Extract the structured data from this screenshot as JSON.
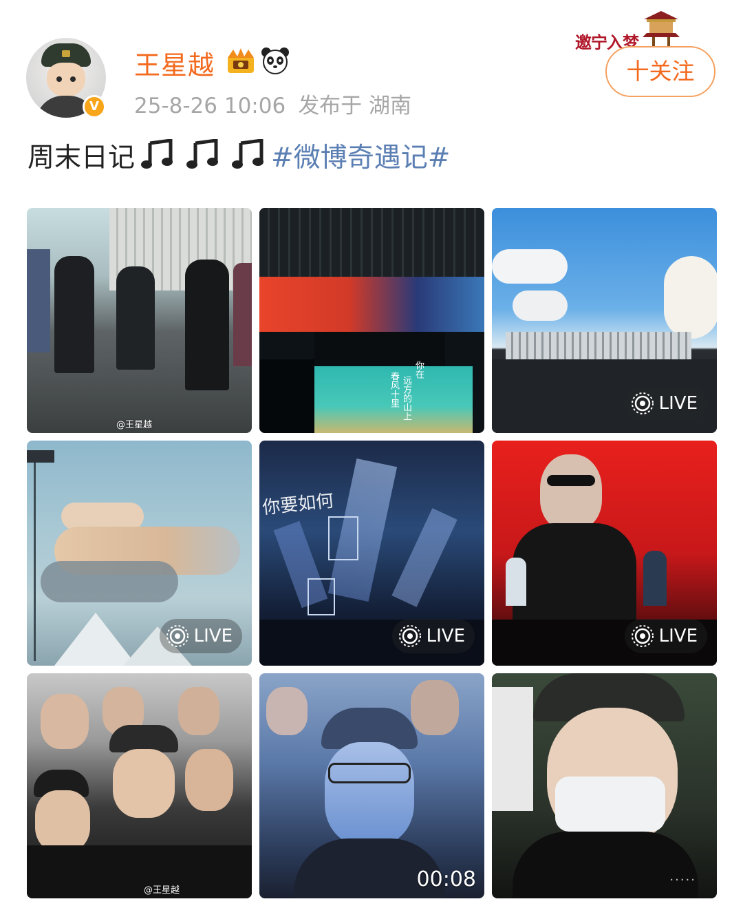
{
  "post": {
    "author": "王星越",
    "date": "25-8-26 10:06",
    "location": "发布于 湖南",
    "follow_label": "十关注",
    "text_main": "周末日记",
    "hashtag": "#微博奇遇记#",
    "stamp_text": "邀宁入梦"
  },
  "colors": {
    "username": "#f36a1e",
    "hashtag": "#5b7fb3",
    "meta": "#a6a6a6",
    "follow_border": "#f5a160"
  },
  "photos": [
    {
      "id": 1,
      "badge": "",
      "watermark": "@王星越"
    },
    {
      "id": 2,
      "badge": "",
      "overlay_line1": "你在",
      "overlay_line2": "远方的山上",
      "overlay_line3": "春风十里"
    },
    {
      "id": 3,
      "badge": "LIVE"
    },
    {
      "id": 4,
      "badge": "LIVE"
    },
    {
      "id": 5,
      "badge": "LIVE",
      "overlay_text": "你要如何"
    },
    {
      "id": 6,
      "badge": "LIVE"
    },
    {
      "id": 7,
      "badge": "",
      "watermark": "@王星越"
    },
    {
      "id": 8,
      "badge": "",
      "duration": "00:08"
    },
    {
      "id": 9,
      "badge": ""
    }
  ]
}
